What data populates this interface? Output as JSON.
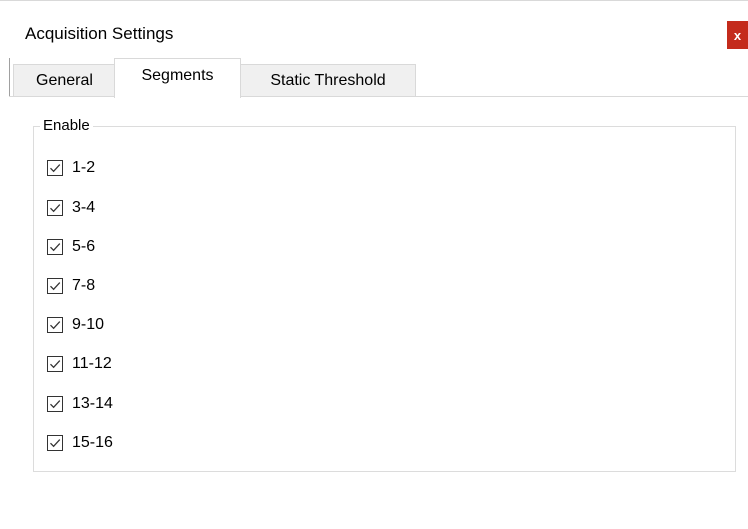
{
  "window": {
    "title": "Acquisition Settings",
    "close_label": "x"
  },
  "tabs": [
    {
      "label": "General",
      "active": false
    },
    {
      "label": "Segments",
      "active": true
    },
    {
      "label": "Static Threshold",
      "active": false
    }
  ],
  "segments_group": {
    "legend": "Enable",
    "items": [
      {
        "label": "1-2",
        "checked": true
      },
      {
        "label": "3-4",
        "checked": true
      },
      {
        "label": "5-6",
        "checked": true
      },
      {
        "label": "7-8",
        "checked": true
      },
      {
        "label": "9-10",
        "checked": true
      },
      {
        "label": "11-12",
        "checked": true
      },
      {
        "label": "13-14",
        "checked": true
      },
      {
        "label": "15-16",
        "checked": true
      }
    ]
  },
  "colors": {
    "close_button": "#c42b1c",
    "border": "#d9d9d9",
    "inactive_tab": "#f0f0f0"
  }
}
